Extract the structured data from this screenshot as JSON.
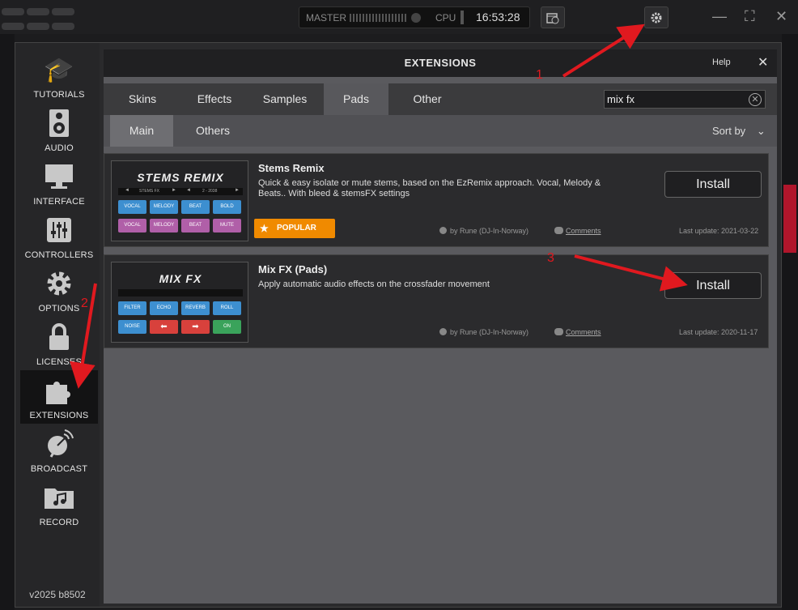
{
  "topbar": {
    "master_label": "MASTER",
    "cpu_label": "CPU",
    "clock": "16:53:28"
  },
  "sidebar": {
    "items": [
      {
        "label": "TUTORIALS",
        "icon": "graduation-cap-icon"
      },
      {
        "label": "AUDIO",
        "icon": "speaker-icon"
      },
      {
        "label": "INTERFACE",
        "icon": "monitor-icon"
      },
      {
        "label": "CONTROLLERS",
        "icon": "sliders-icon"
      },
      {
        "label": "OPTIONS",
        "icon": "gear-icon"
      },
      {
        "label": "LICENSES",
        "icon": "lock-icon"
      },
      {
        "label": "EXTENSIONS",
        "icon": "puzzle-icon"
      },
      {
        "label": "BROADCAST",
        "icon": "satellite-dish-icon"
      },
      {
        "label": "RECORD",
        "icon": "music-folder-icon"
      }
    ],
    "active": "EXTENSIONS",
    "version": "v2025 b8502"
  },
  "panel": {
    "title": "EXTENSIONS",
    "help": "Help",
    "close": "✕",
    "tabs": [
      "Skins",
      "Effects",
      "Samples",
      "Pads",
      "Other"
    ],
    "active_tab": "Pads",
    "search_value": "mix fx",
    "subtabs": [
      "Main",
      "Others"
    ],
    "active_subtab": "Main",
    "sort_label": "Sort by"
  },
  "extensions": [
    {
      "thumb_title": "STEMS REMIX",
      "thumb_strip": [
        "◄",
        "STEMS FX",
        "►",
        "◄",
        "2 - 2038",
        "►"
      ],
      "pads": [
        "VOCAL",
        "MELODY",
        "BEAT",
        "BOLD",
        "VOCAL",
        "MELODY",
        "BEAT",
        "MUTE"
      ],
      "title": "Stems Remix",
      "description": "Quick & easy isolate or mute stems, based on the EzRemix approach. Vocal, Melody & Beats.. With bleed & stemsFX settings",
      "badge": "POPULAR",
      "install": "Install",
      "author": "by Rune (DJ-In-Norway)",
      "comments": "Comments",
      "last_update": "Last update: 2021-03-22"
    },
    {
      "thumb_title": "MIX FX",
      "pads": [
        "FILTER",
        "ECHO",
        "REVERB",
        "ROLL",
        "NOISE",
        "⬅",
        "➡",
        "ON"
      ],
      "title": "Mix FX (Pads)",
      "description": "Apply automatic audio effects on the crossfader movement",
      "install": "Install",
      "author": "by Rune (DJ-In-Norway)",
      "comments": "Comments",
      "last_update": "Last update: 2020-11-17"
    }
  ],
  "annotations": [
    "1",
    "2",
    "3"
  ],
  "colors": {
    "accent_red": "#e0191f",
    "badge_orange": "#f08a00",
    "pad_blue": "#3d8fd0",
    "pad_pink": "#b05fa8",
    "pad_red": "#d8413c",
    "pad_green": "#3aa35b"
  }
}
